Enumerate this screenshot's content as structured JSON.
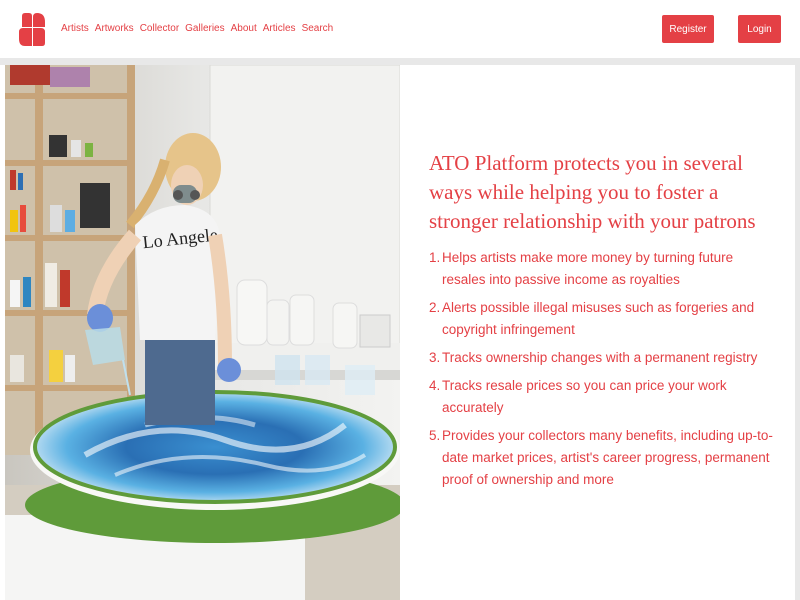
{
  "nav": {
    "logo_icon": "ato-logo-icon",
    "brand_color": "#e44045",
    "links": [
      "Artists",
      "Artworks",
      "Collector",
      "Galleries",
      "About",
      "Articles",
      "Search"
    ],
    "register_label": "Register",
    "login_label": "Login"
  },
  "hero": {
    "image_alt": "Artist in respirator mask pouring blue resin onto a large circular canvas in a studio",
    "heading": "ATO Platform protects you in several ways while helping you to foster a stronger relationship with your patrons",
    "benefits": [
      {
        "num": "1.",
        "text": "Helps artists make more money by turning future resales into passive income as royalties"
      },
      {
        "num": "2.",
        "text": "Alerts possible illegal misuses such as forgeries and copyright infringement"
      },
      {
        "num": "3.",
        "text": "Tracks ownership changes with a permanent registry"
      },
      {
        "num": "4.",
        "text": "Tracks resale prices so you can price your work accurately"
      },
      {
        "num": "5.",
        "text": "Provides your collectors many benefits, including up-to-date market prices, artist's career progress, permanent proof of ownership and more"
      }
    ]
  }
}
